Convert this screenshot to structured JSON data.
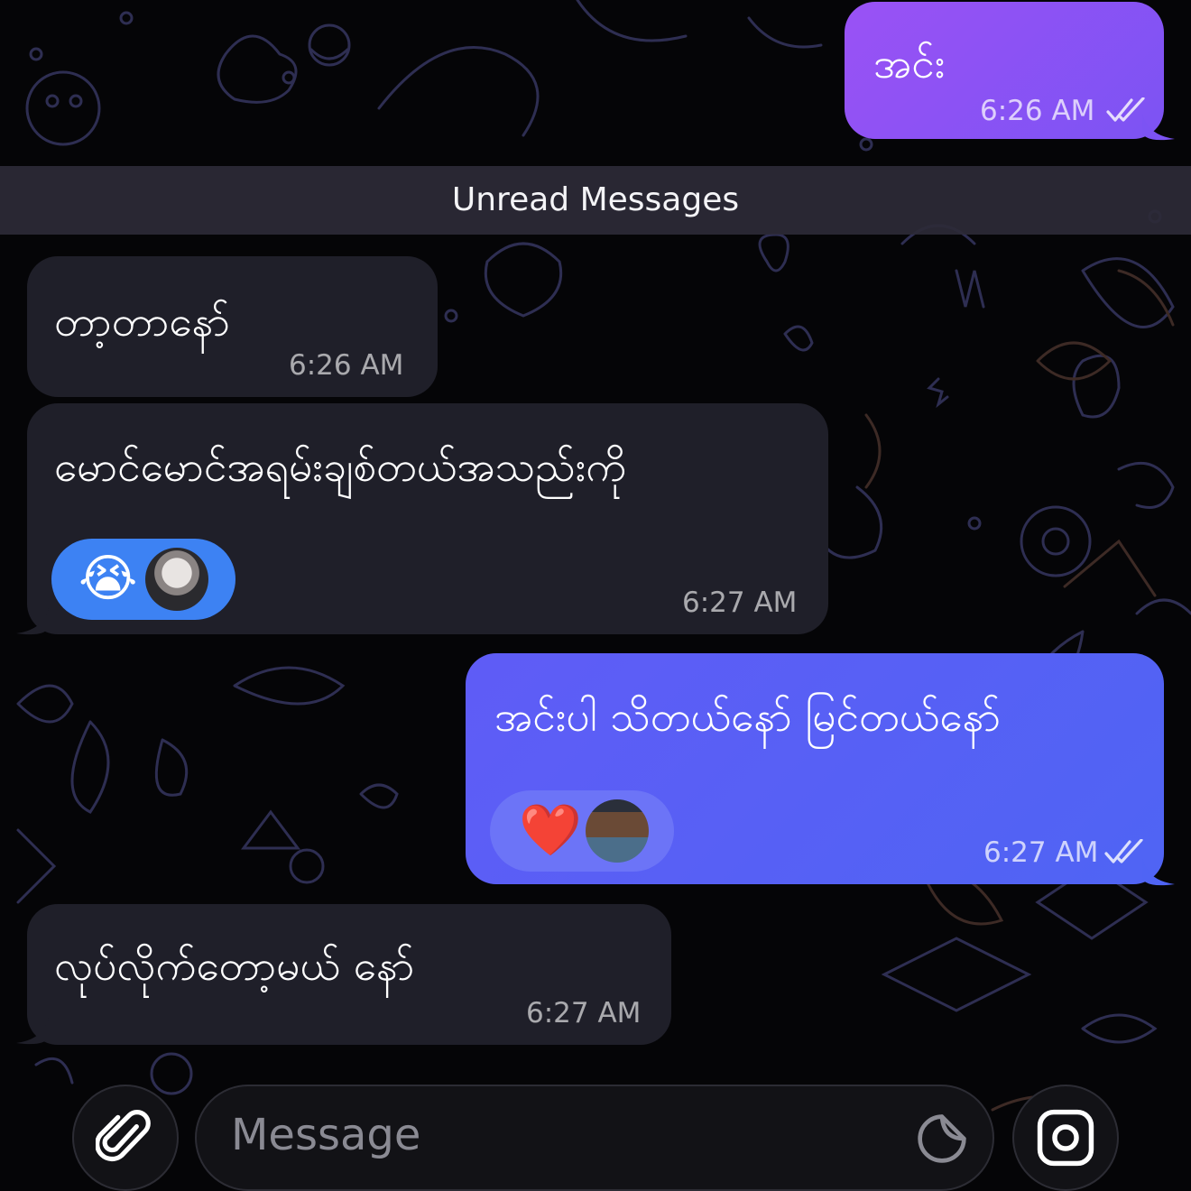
{
  "chat": {
    "unread_label": "Unread Messages",
    "messages": [
      {
        "direction": "outgoing",
        "text": "အင်း",
        "time": "6:26 AM",
        "status": "read"
      },
      {
        "direction": "incoming",
        "text": "တာ့တာနော်",
        "time": "6:26 AM"
      },
      {
        "direction": "incoming",
        "text": "မောင်မောင်အရမ်းချစ်တယ်အသည်းကို",
        "time": "6:27 AM",
        "reaction_emoji": "😭"
      },
      {
        "direction": "outgoing",
        "text": "အင်းပါ သိတယ်နော် မြင်တယ်နော်",
        "time": "6:27 AM",
        "status": "read",
        "reaction_emoji": "❤️"
      },
      {
        "direction": "incoming",
        "text": "လုပ်လိုက်တော့မယ် နော်",
        "time": "6:27 AM"
      }
    ]
  },
  "composer": {
    "placeholder": "Message",
    "attach_icon": "paperclip-icon",
    "sticker_icon": "sticker-icon",
    "camera_icon": "camera-icon"
  },
  "colors": {
    "outgoing_purple": "#8f53f4",
    "outgoing_blue": "#5661f5",
    "incoming": "#1f1f29",
    "reaction_incoming": "#3d82f3",
    "reaction_outgoing": "#6c74f7",
    "background": "#050507"
  }
}
